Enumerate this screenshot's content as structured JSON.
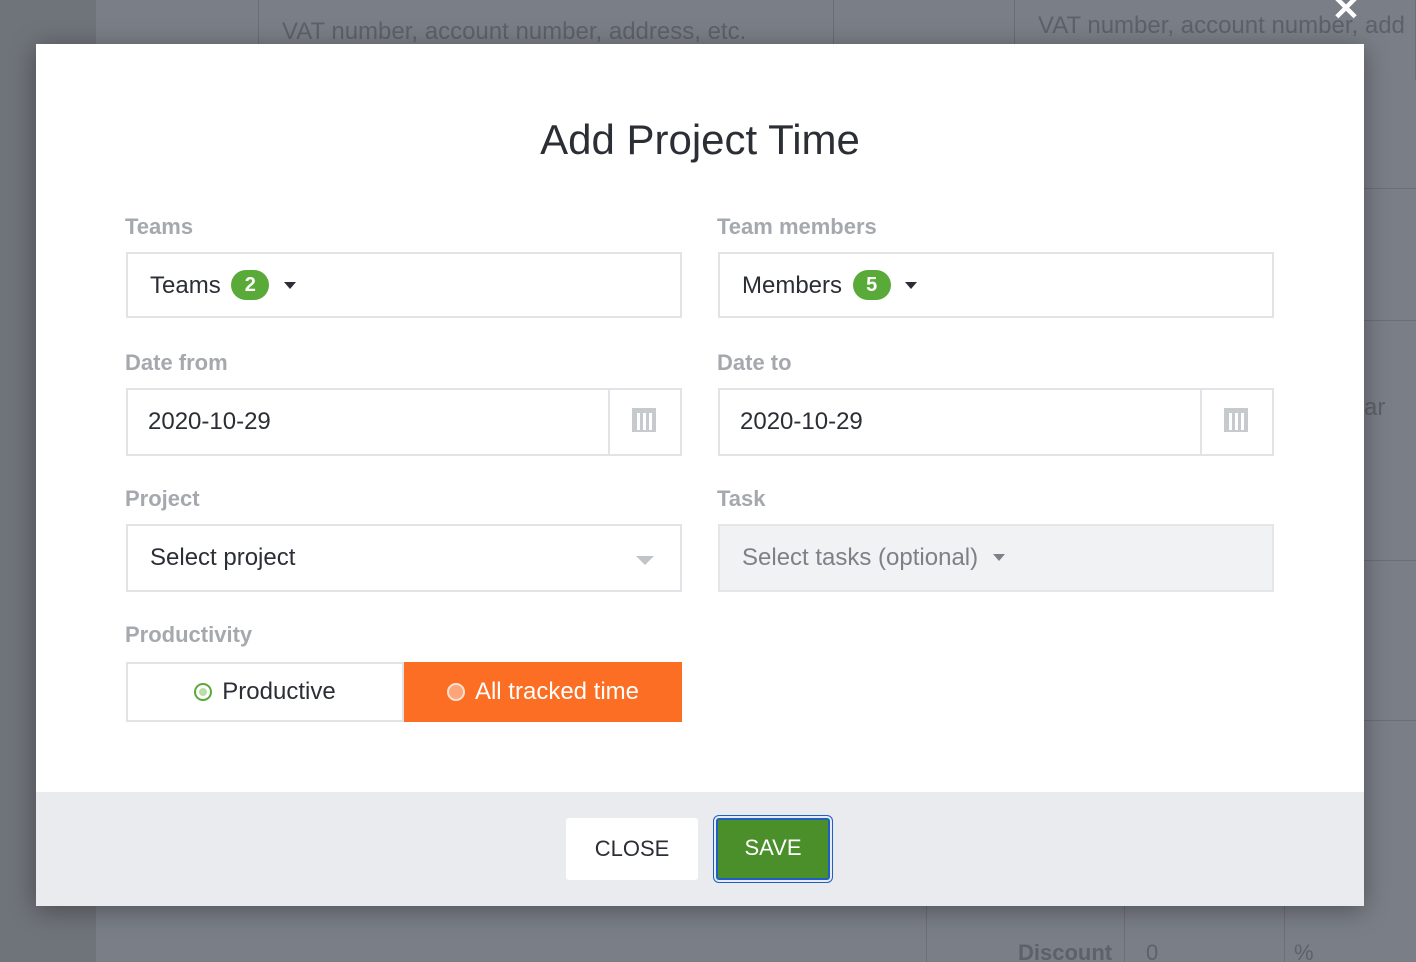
{
  "background": {
    "placeholder_left": "VAT number, account number, address, etc.",
    "placeholder_right": "VAT number, account number, add",
    "fragment": "ar",
    "discount_label": "Discount",
    "discount_value": "0",
    "discount_unit": "%"
  },
  "modal": {
    "title": "Add Project Time",
    "teams": {
      "label": "Teams",
      "button_text": "Teams",
      "count": "2"
    },
    "members": {
      "label": "Team members",
      "button_text": "Members",
      "count": "5"
    },
    "date_from": {
      "label": "Date from",
      "value": "2020-10-29"
    },
    "date_to": {
      "label": "Date to",
      "value": "2020-10-29"
    },
    "project": {
      "label": "Project",
      "value": "Select project"
    },
    "task": {
      "label": "Task",
      "value": "Select tasks (optional)"
    },
    "productivity": {
      "label": "Productivity",
      "options": [
        "Productive",
        "All tracked time"
      ],
      "selected": "All tracked time"
    },
    "buttons": {
      "close": "CLOSE",
      "save": "SAVE"
    }
  },
  "colors": {
    "accent_orange": "#fb6e23",
    "badge_green": "#5aaa3a",
    "save_green": "#4a8f2a",
    "focus_blue": "#1f60c4"
  }
}
